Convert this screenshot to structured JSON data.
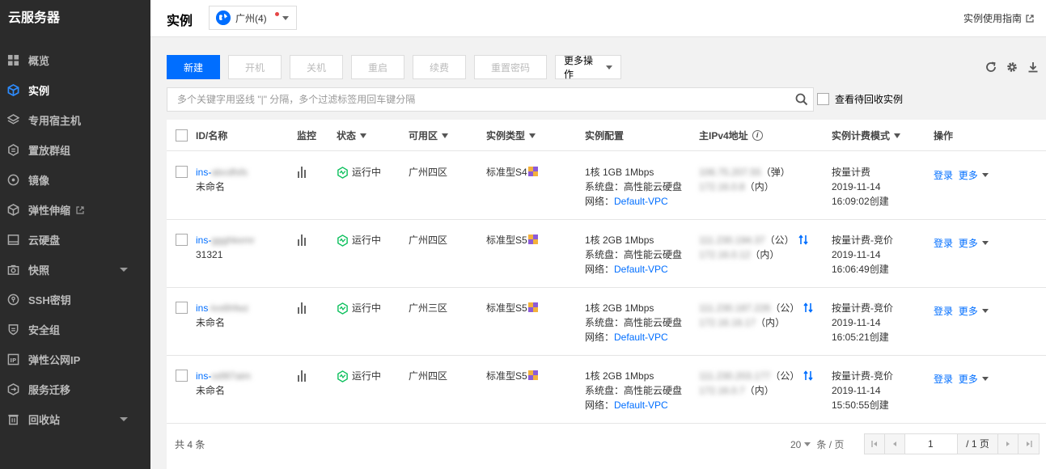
{
  "sidebar": {
    "title": "云服务器",
    "items": [
      {
        "label": "概览",
        "icon": "dashboard-icon"
      },
      {
        "label": "实例",
        "icon": "cube-icon",
        "active": true
      },
      {
        "label": "专用宿主机",
        "icon": "layers-icon"
      },
      {
        "label": "置放群组",
        "icon": "placement-group-icon"
      },
      {
        "label": "镜像",
        "icon": "disc-icon"
      },
      {
        "label": "弹性伸缩",
        "icon": "scaling-icon",
        "external": true
      },
      {
        "label": "云硬盘",
        "icon": "harddisk-icon"
      },
      {
        "label": "快照",
        "icon": "camera-icon",
        "expandable": true
      },
      {
        "label": "SSH密钥",
        "icon": "key-icon"
      },
      {
        "label": "安全组",
        "icon": "shield-icon"
      },
      {
        "label": "弹性公网IP",
        "icon": "ip-icon"
      },
      {
        "label": "服务迁移",
        "icon": "migration-icon"
      },
      {
        "label": "回收站",
        "icon": "recycle-bin-icon",
        "expandable": true
      }
    ]
  },
  "header": {
    "title": "实例",
    "region": "广州(4)",
    "guide_link": "实例使用指南"
  },
  "toolbar": {
    "new": "新建",
    "start": "开机",
    "shutdown": "关机",
    "restart": "重启",
    "renew": "续费",
    "reset_password": "重置密码",
    "more_actions": "更多操作"
  },
  "search": {
    "placeholder": "多个关键字用竖线 \"|\" 分隔，多个过滤标签用回车键分隔",
    "recycle_label": "查看待回收实例"
  },
  "table": {
    "headers": {
      "id": "ID/名称",
      "monitor": "监控",
      "status": "状态",
      "zone": "可用区",
      "type": "实例类型",
      "config": "实例配置",
      "ip": "主IPv4地址",
      "billing": "实例计费模式",
      "ops": "操作"
    },
    "rows": [
      {
        "id": "ins-",
        "id_blur": "abcdfsfs",
        "name": "未命名",
        "status": "运行中",
        "zone": "广州四区",
        "type": "标准型S4",
        "cpu": "1核 1GB 1Mbps",
        "disk": "系统盘：高性能云硬盘",
        "net_label": "网络：",
        "vpc": "Default-VPC",
        "ip_pub": "106.75.207.55",
        "ip_pub_tag": "（弹）",
        "ip_priv": "172.16.0.8",
        "ip_priv_tag": "（内）",
        "billing": "按量计费",
        "date": "2019-11-14",
        "created": "16:09:02创建",
        "login": "登录",
        "more": "更多"
      },
      {
        "id": "ins-",
        "id_blur": "ggghkemr",
        "name": "31321",
        "status": "运行中",
        "zone": "广州四区",
        "type": "标准型S5",
        "cpu": "1核 2GB 1Mbps",
        "disk": "系统盘：高性能云硬盘",
        "net_label": "网络：",
        "vpc": "Default-VPC",
        "ip_pub": "111.230.194.37",
        "ip_pub_tag": "（公）",
        "ip_priv": "172.16.0.12",
        "ip_priv_tag": "（内）",
        "billing": "按量计费-竞价",
        "date": "2019-11-14",
        "created": "16:06:49创建",
        "login": "登录",
        "more": "更多"
      },
      {
        "id": "ins",
        "id_blur": "-lvs6hfwz",
        "name": "未命名",
        "status": "运行中",
        "zone": "广州三区",
        "type": "标准型S5",
        "cpu": "1核 2GB 1Mbps",
        "disk": "系统盘：高性能云硬盘",
        "net_label": "网络：",
        "vpc": "Default-VPC",
        "ip_pub": "111.230.187.226",
        "ip_pub_tag": "（公）",
        "ip_priv": "172.16.16.17",
        "ip_priv_tag": "（内）",
        "billing": "按量计费-竞价",
        "date": "2019-11-14",
        "created": "16:05:21创建",
        "login": "登录",
        "more": "更多"
      },
      {
        "id": "ins-",
        "id_blur": "od9l7aim",
        "name": "未命名",
        "status": "运行中",
        "zone": "广州四区",
        "type": "标准型S5",
        "cpu": "1核 2GB 1Mbps",
        "disk": "系统盘：高性能云硬盘",
        "net_label": "网络：",
        "vpc": "Default-VPC",
        "ip_pub": "111.230.203.177",
        "ip_pub_tag": "（公）",
        "ip_priv": "172.16.0.7",
        "ip_priv_tag": "（内）",
        "billing": "按量计费-竞价",
        "date": "2019-11-14",
        "created": "15:50:55创建",
        "login": "登录",
        "more": "更多"
      }
    ]
  },
  "footer": {
    "total": "共 4 条",
    "page_size": "20",
    "page_size_unit": "条 / 页",
    "current_page": "1",
    "total_pages": "/ 1 页"
  },
  "colors": {
    "primary": "#006eff",
    "sidebar_bg": "#2b2b2b",
    "running_green": "#0abf5b"
  }
}
